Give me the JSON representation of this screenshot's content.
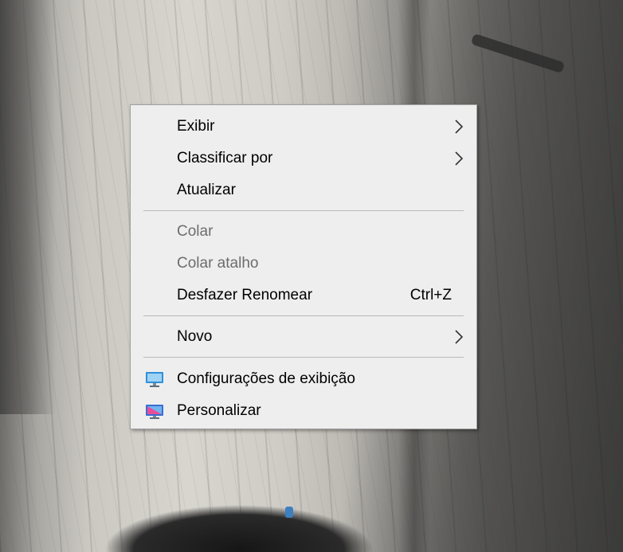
{
  "context_menu": {
    "items": [
      {
        "label": "Exibir",
        "submenu": true
      },
      {
        "label": "Classificar por",
        "submenu": true
      },
      {
        "label": "Atualizar"
      },
      {
        "label": "Colar",
        "disabled": true
      },
      {
        "label": "Colar atalho",
        "disabled": true
      },
      {
        "label": "Desfazer Renomear",
        "shortcut": "Ctrl+Z"
      },
      {
        "label": "Novo",
        "submenu": true
      },
      {
        "label": "Configurações de exibição",
        "icon": "display-settings-icon",
        "highlighted": true
      },
      {
        "label": "Personalizar",
        "icon": "personalize-icon"
      }
    ]
  },
  "colors": {
    "highlight_border": "#f0862c",
    "menu_background": "#eeeeee"
  }
}
